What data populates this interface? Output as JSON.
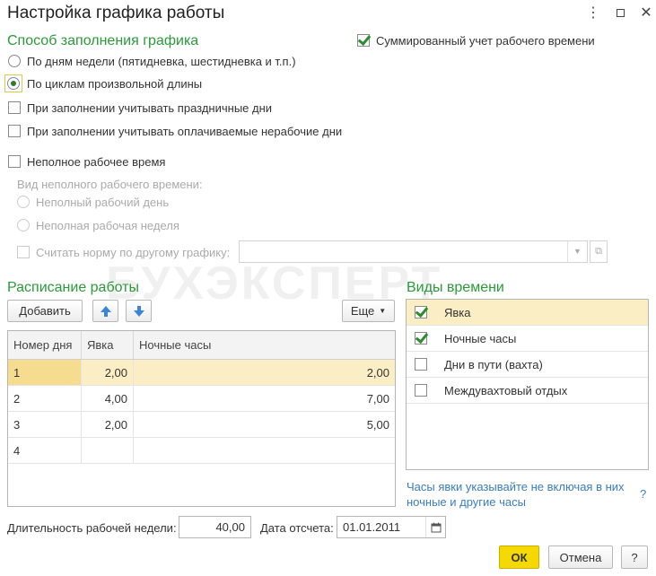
{
  "window": {
    "title": "Настройка графика работы"
  },
  "watermark": "БУХЭКСПЕРТ",
  "fill_method": {
    "title": "Способ заполнения графика",
    "by_weekdays": "По дням недели (пятидневка, шестидневка и т.п.)",
    "by_cycles": "По циклам произвольной длины",
    "consider_holidays": "При заполнении учитывать праздничные дни",
    "consider_paid_nonworking": "При заполнении учитывать оплачиваемые нерабочие дни",
    "summarized_accounting": "Суммированный учет рабочего времени",
    "part_time": "Неполное рабочее время",
    "part_time_kind_label": "Вид неполного рабочего времени:",
    "part_time_day": "Неполный рабочий день",
    "part_time_week": "Неполная рабочая неделя",
    "norm_by_other_schedule": "Считать норму по другому графику:"
  },
  "schedule": {
    "title": "Расписание работы",
    "add_button": "Добавить",
    "more_button": "Еще",
    "columns": [
      "Номер дня",
      "Явка",
      "Ночные часы"
    ],
    "rows": [
      {
        "day": "1",
        "attendance": "2,00",
        "night": "2,00"
      },
      {
        "day": "2",
        "attendance": "4,00",
        "night": "7,00"
      },
      {
        "day": "3",
        "attendance": "2,00",
        "night": "5,00"
      },
      {
        "day": "4",
        "attendance": "",
        "night": ""
      }
    ]
  },
  "time_types": {
    "title": "Виды времени",
    "items": [
      {
        "label": "Явка",
        "checked": true
      },
      {
        "label": "Ночные часы",
        "checked": true
      },
      {
        "label": "Дни в пути (вахта)",
        "checked": false
      },
      {
        "label": "Междувахтовый отдых",
        "checked": false
      }
    ],
    "hint": "Часы явки указывайте не включая в них ночные и другие часы",
    "help_mark": "?"
  },
  "footer": {
    "week_length_label": "Длительность рабочей недели:",
    "week_length_value": "40,00",
    "start_date_label": "Дата отсчета:",
    "start_date_value": "01.01.2011",
    "ok_button": "ОК",
    "cancel_button": "Отмена",
    "help_button": "?"
  },
  "colors": {
    "accent_green": "#2a9a3a",
    "selection": "#fbeec4",
    "ok_button": "#f5d800",
    "link": "#3a7dbd"
  }
}
